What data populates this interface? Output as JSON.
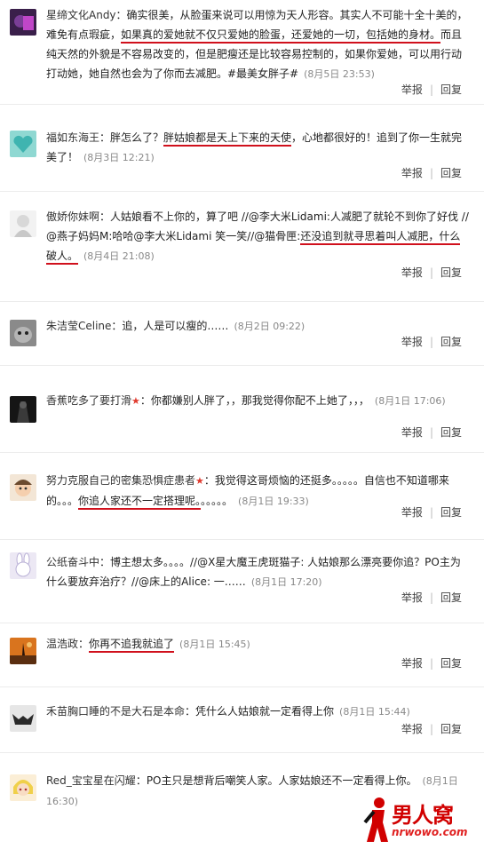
{
  "actions": {
    "report": "举报",
    "sep": "|",
    "reply": "回复"
  },
  "comments": [
    {
      "user": "星缔文化Andy",
      "segments": [
        {
          "t": "：确实很美，从脸蛋来说可以用惊为天人形容。其实人不可能十全十美的，难免有点瑕疵，",
          "h": false
        },
        {
          "t": "如果真的爱她就不仅只爱她的脸蛋，还爱她的一切，包括她的身材。",
          "h": true
        },
        {
          "t": "而且纯天然的外貌是不容易改变的，但是肥瘦还是比较容易控制的，如果你爱她，可以用行动打动她，她自然也会为了你而去减肥。#最美女胖子#",
          "h": false
        }
      ],
      "time": "(8月5日 23:53)",
      "badge": ""
    },
    {
      "user": "福如东海王",
      "segments": [
        {
          "t": "：胖怎么了？",
          "h": false
        },
        {
          "t": "胖姑娘都是天上下来的天使",
          "h": true
        },
        {
          "t": "，心地都很好的！追到了你一生就完美了！",
          "h": false
        }
      ],
      "time": "(8月3日 12:21)",
      "badge": ""
    },
    {
      "user": "傲娇你妹啊",
      "segments": [
        {
          "t": "：人姑娘看不上你的，算了吧 //@李大米Lidami:人减肥了就轮不到你了好伐 //@燕子妈妈M:哈哈@李大米Lidami 笑一笑//@猫骨匣:",
          "h": false
        },
        {
          "t": "还没追到就寻思着叫人减肥，什么破人。",
          "h": true
        }
      ],
      "time": "(8月4日 21:08)",
      "badge": ""
    },
    {
      "user": "朱洁莹Celine",
      "segments": [
        {
          "t": "：追，人是可以瘦的……",
          "h": false
        }
      ],
      "time": "(8月2日 09:22)",
      "badge": ""
    },
    {
      "user": "香蕉吃多了要打滑",
      "segments": [
        {
          "t": "：你都嫌别人胖了，，那我觉得你配不上她了，，，",
          "h": false
        }
      ],
      "time": "(8月1日 17:06)",
      "badge": "★"
    },
    {
      "user": "努力克服自己的密集恐惧症患者",
      "segments": [
        {
          "t": "：我觉得这哥烦恼的还挺多。。。。。自信也不知道哪来的。。。",
          "h": false
        },
        {
          "t": "你追人家还不一定搭理呢。",
          "h": true
        },
        {
          "t": "。。。。。",
          "h": false
        }
      ],
      "time": "(8月1日 19:33)",
      "badge": "★"
    },
    {
      "user": "公纸奋斗中",
      "segments": [
        {
          "t": "：博主想太多。。。。//@X星大魔王虎斑猫子: 人姑娘那么漂亮要你追？PO主为什么要放弃治疗？//@床上的Alice: 一……",
          "h": false
        }
      ],
      "time": "(8月1日 17:20)",
      "badge": ""
    },
    {
      "user": "温浩政",
      "segments": [
        {
          "t": "：",
          "h": false
        },
        {
          "t": "你再不追我就追了",
          "h": true
        }
      ],
      "time": "(8月1日 15:45)",
      "badge": ""
    },
    {
      "user": "禾苗胸口睡的不是大石是本命",
      "segments": [
        {
          "t": "：凭什么人姑娘就一定看得上你",
          "h": false
        }
      ],
      "time": "(8月1日 15:44)",
      "badge": ""
    },
    {
      "user": "Red_宝宝星在闪耀",
      "segments": [
        {
          "t": "：PO主只是想背后嘲笑人家。人家姑娘还不一定看得上你。",
          "h": false
        }
      ],
      "time": "(8月1日 16:30)",
      "badge": ""
    }
  ],
  "logo": {
    "cn": "男人窝",
    "url": "nrwowo.com"
  }
}
